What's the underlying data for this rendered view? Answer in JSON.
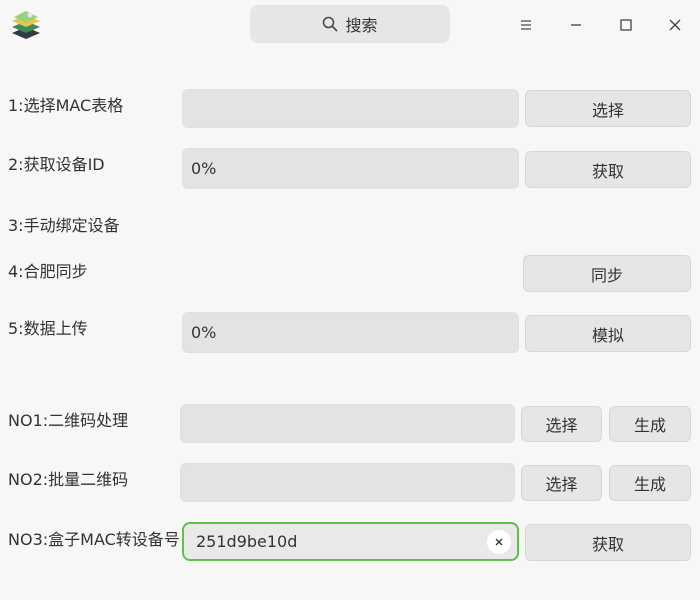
{
  "titlebar": {
    "app_icon": "layered-map-icon",
    "search_label": "搜索",
    "search_icon": "search-icon",
    "menu_icon": "hamburger-menu-icon",
    "minimize_icon": "minimize-icon",
    "maximize_icon": "maximize-icon",
    "close_icon": "close-icon"
  },
  "steps": {
    "step1": {
      "label": "1:选择MAC表格",
      "field_value": "",
      "button": "选择"
    },
    "step2": {
      "label": "2:获取设备ID",
      "progress": "0%",
      "button": "获取"
    },
    "step3": {
      "label": "3:手动绑定设备"
    },
    "step4": {
      "label": "4:合肥同步",
      "button": "同步"
    },
    "step5": {
      "label": "5:数据上传",
      "progress": "0%",
      "button": "模拟"
    }
  },
  "qrcode": {
    "no1": {
      "label": "NO1:二维码处理",
      "field_value": "",
      "select_button": "选择",
      "generate_button": "生成"
    },
    "no2": {
      "label": "NO2:批量二维码",
      "field_value": "",
      "select_button": "选择",
      "generate_button": "生成"
    },
    "no3": {
      "label": "NO3:盒子MAC转设备号",
      "input_value": "251d9be10d",
      "button": "获取"
    }
  },
  "colors": {
    "background": "#f7f7f7",
    "field": "#e3e3e3",
    "button": "#e6e6e6",
    "focus_border": "#5bc24a"
  }
}
